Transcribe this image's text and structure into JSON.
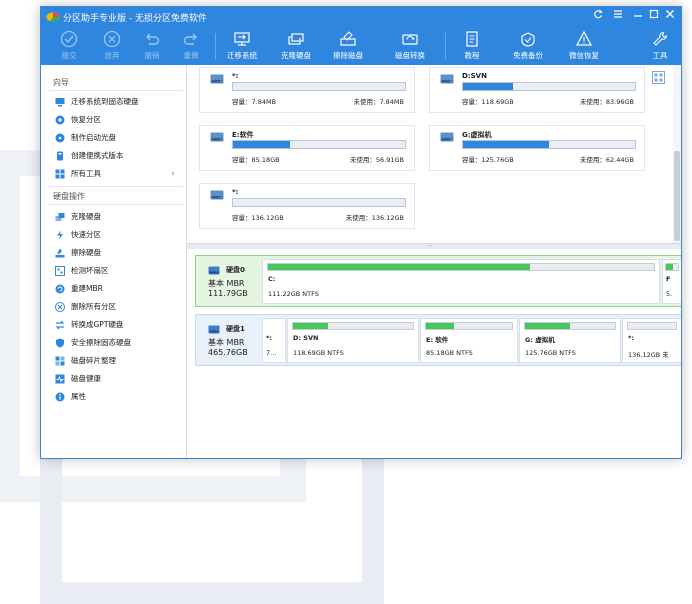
{
  "window": {
    "title": "分区助手专业版 - 无损分区免费软件"
  },
  "toolbar": {
    "items": [
      {
        "label": "提交",
        "icon": "check-icon",
        "enabled": false
      },
      {
        "label": "放弃",
        "icon": "cancel-icon",
        "enabled": false
      },
      {
        "label": "撤销",
        "icon": "undo-icon",
        "enabled": false
      },
      {
        "label": "重做",
        "icon": "redo-icon",
        "enabled": false
      },
      {
        "label": "迁移系统",
        "icon": "migrate-icon",
        "enabled": true
      },
      {
        "label": "克隆硬盘",
        "icon": "clone-disk-icon",
        "enabled": true
      },
      {
        "label": "擦除磁盘",
        "icon": "wipe-disk-icon",
        "enabled": true
      },
      {
        "label": "磁盘转换",
        "icon": "convert-disk-icon",
        "enabled": true
      },
      {
        "label": "教程",
        "icon": "tutorial-icon",
        "enabled": true
      },
      {
        "label": "免费备份",
        "icon": "backup-icon",
        "enabled": true
      },
      {
        "label": "微信恢复",
        "icon": "recover-icon",
        "enabled": true
      },
      {
        "label": "工具",
        "icon": "tools-icon",
        "enabled": true
      }
    ]
  },
  "sidebar": {
    "wizard_heading": "向导",
    "wizard_items": [
      {
        "label": "迁移系统到固态硬盘",
        "icon": "migrate-icon"
      },
      {
        "label": "恢复分区",
        "icon": "recover-partition-icon"
      },
      {
        "label": "制作启动光盘",
        "icon": "boot-disc-icon"
      },
      {
        "label": "创建便携式版本",
        "icon": "portable-icon"
      },
      {
        "label": "所有工具",
        "icon": "all-tools-icon",
        "has_submenu": true
      }
    ],
    "disk_heading": "硬盘操作",
    "disk_items": [
      {
        "label": "克隆硬盘",
        "icon": "clone-disk-icon"
      },
      {
        "label": "快速分区",
        "icon": "lightning-icon"
      },
      {
        "label": "擦除硬盘",
        "icon": "wipe-disk-icon"
      },
      {
        "label": "检测坏扇区",
        "icon": "bad-sector-icon"
      },
      {
        "label": "重建MBR",
        "icon": "rebuild-mbr-icon"
      },
      {
        "label": "删除所有分区",
        "icon": "delete-partitions-icon"
      },
      {
        "label": "转换成GPT硬盘",
        "icon": "convert-gpt-icon"
      },
      {
        "label": "安全擦除固态硬盘",
        "icon": "secure-erase-icon"
      },
      {
        "label": "磁盘碎片整理",
        "icon": "defrag-icon"
      },
      {
        "label": "磁盘健康",
        "icon": "disk-health-icon"
      },
      {
        "label": "属性",
        "icon": "info-icon"
      }
    ]
  },
  "partition_cards": [
    {
      "name": "*:",
      "capacity": "容量：7.84MB",
      "free": "未使用：7.84MB",
      "used_fraction": 0.0
    },
    {
      "name": "D:SVN",
      "capacity": "容量：118.69GB",
      "free": "未使用：83.96GB",
      "used_fraction": 0.29
    },
    {
      "name": "E:软件",
      "capacity": "容量：85.18GB",
      "free": "未使用：56.91GB",
      "used_fraction": 0.33
    },
    {
      "name": "G:虚拟机",
      "capacity": "容量：125.76GB",
      "free": "未使用：62.44GB",
      "used_fraction": 0.5
    },
    {
      "name": "*:",
      "capacity": "容量：136.12GB",
      "free": "未使用：136.12GB",
      "used_fraction": 0.0
    }
  ],
  "disks": [
    {
      "name": "硬盘0",
      "type": "基本 MBR",
      "size": "111.79GB",
      "selected": true,
      "partitions": [
        {
          "name": "C:",
          "fs": "111.22GB NTFS",
          "used_fraction": 0.68
        },
        {
          "name": "F",
          "fs": "5.",
          "used_fraction": 0.6
        }
      ]
    },
    {
      "name": "硬盘1",
      "type": "基本 MBR",
      "size": "465.76GB",
      "selected": false,
      "partitions": [
        {
          "name": "*:",
          "fs": "7...",
          "used_fraction": 0.0
        },
        {
          "name": "D: SVN",
          "fs": "118.69GB NTFS",
          "used_fraction": 0.29
        },
        {
          "name": "E: 软件",
          "fs": "85.18GB NTFS",
          "used_fraction": 0.33
        },
        {
          "name": "G: 虚拟机",
          "fs": "125.76GB NTFS",
          "used_fraction": 0.5
        },
        {
          "name": "*:",
          "fs": "136.12GB 未",
          "used_fraction": 0.0
        }
      ]
    }
  ],
  "colors": {
    "accent": "#2f86df",
    "used_bar": "#2f86df",
    "disk_used_bar": "#44c858",
    "selected_row": "#e4f6e1"
  }
}
